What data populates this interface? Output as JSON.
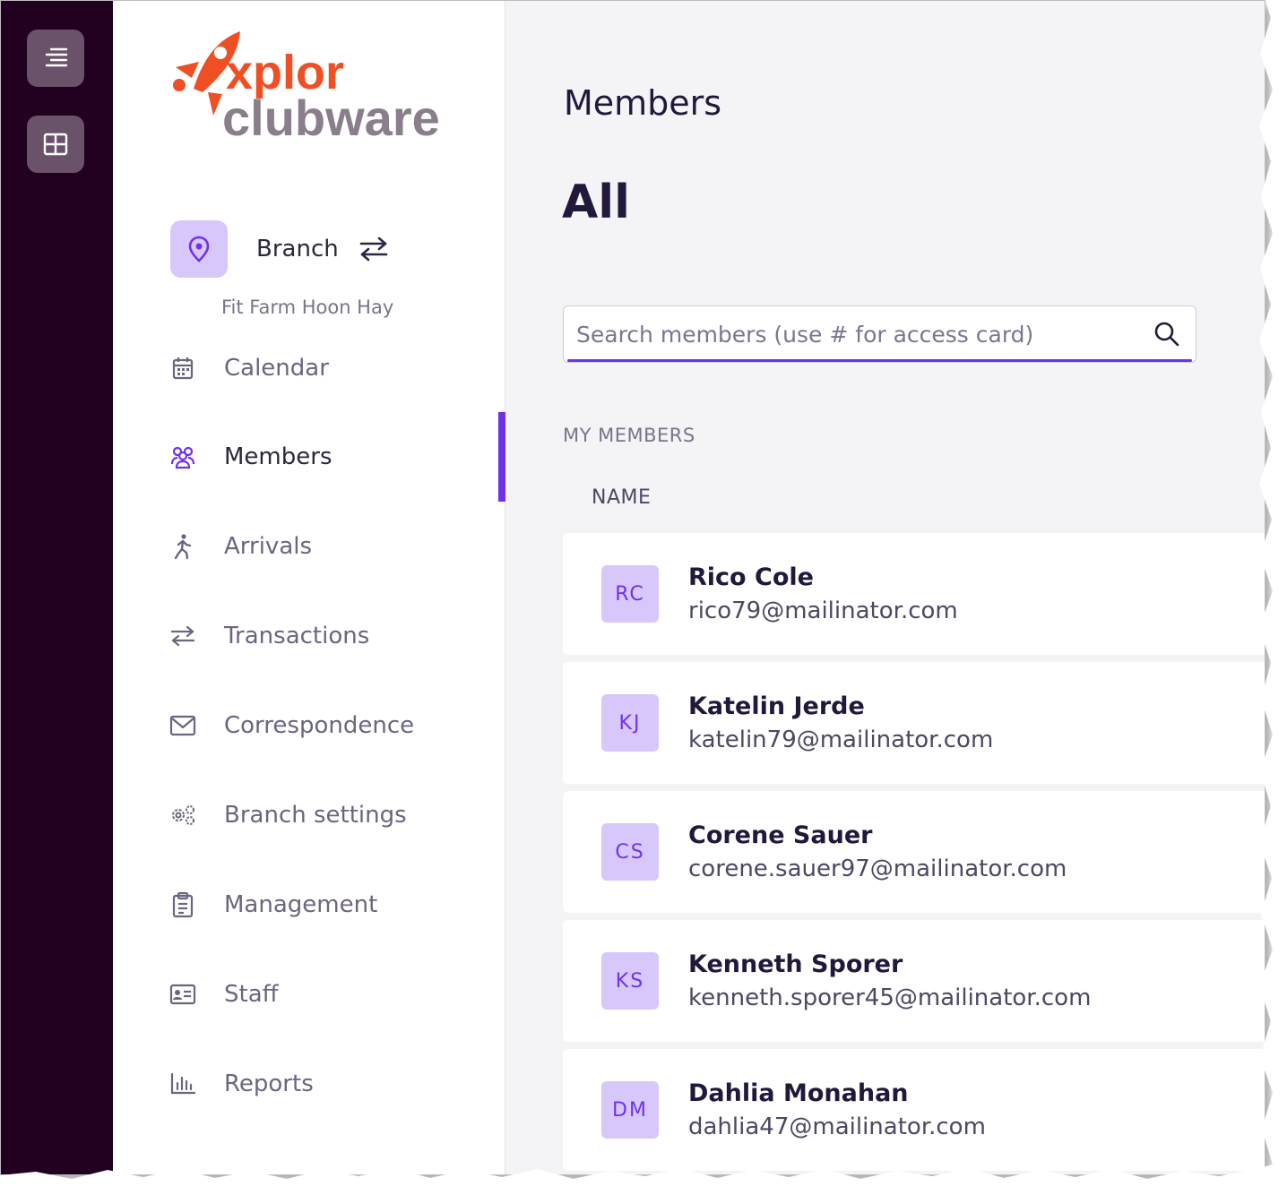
{
  "brand": {
    "logo_line1": "xplor",
    "logo_line2": "clubware",
    "orange": "#f04e23",
    "purple": "#6f32ec",
    "gray": "#7d7080"
  },
  "rail": {
    "menu_icon": "menu-lines-icon",
    "grid_icon": "grid-icon"
  },
  "branch": {
    "label": "Branch",
    "name": "Fit Farm Hoon Hay",
    "icon": "location-pin-icon",
    "switch_icon": "swap-arrows-icon"
  },
  "nav": {
    "items": [
      {
        "label": "Calendar",
        "icon": "calendar-icon"
      },
      {
        "label": "Members",
        "icon": "members-icon",
        "active": true
      },
      {
        "label": "Arrivals",
        "icon": "walking-person-icon"
      },
      {
        "label": "Transactions",
        "icon": "swap-arrows-icon"
      },
      {
        "label": "Correspondence",
        "icon": "envelope-icon"
      },
      {
        "label": "Branch settings",
        "icon": "gears-icon"
      },
      {
        "label": "Management",
        "icon": "clipboard-icon"
      },
      {
        "label": "Staff",
        "icon": "id-card-icon"
      },
      {
        "label": "Reports",
        "icon": "bar-chart-icon"
      }
    ]
  },
  "main": {
    "title": "Members",
    "subtitle": "All",
    "search": {
      "placeholder": "Search members (use # for access card)",
      "value": ""
    },
    "section_label": "MY MEMBERS",
    "column_header": "NAME",
    "members": [
      {
        "initials": "RC",
        "name": "Rico Cole",
        "email": "rico79@mailinator.com"
      },
      {
        "initials": "KJ",
        "name": "Katelin Jerde",
        "email": "katelin79@mailinator.com"
      },
      {
        "initials": "CS",
        "name": "Corene Sauer",
        "email": "corene.sauer97@mailinator.com"
      },
      {
        "initials": "KS",
        "name": "Kenneth Sporer",
        "email": "kenneth.sporer45@mailinator.com"
      },
      {
        "initials": "DM",
        "name": "Dahlia Monahan",
        "email": "dahlia47@mailinator.com"
      }
    ]
  }
}
